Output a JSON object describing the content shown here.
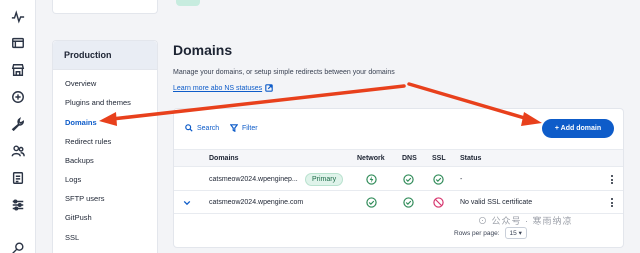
{
  "rail": {
    "icons": [
      "activity-icon",
      "window-icon",
      "store-icon",
      "plus-circle-icon",
      "wrench-icon",
      "users-icon",
      "document-icon",
      "sliders-icon",
      "search-icon"
    ]
  },
  "env_nav": {
    "heading": "Production",
    "items": [
      "Overview",
      "Plugins and themes",
      "Domains",
      "Redirect rules",
      "Backups",
      "Logs",
      "SFTP users",
      "GitPush",
      "SSL"
    ],
    "active_index": 2
  },
  "main": {
    "title": "Domains",
    "description": "Manage your domains, or setup simple redirects between your domains",
    "learn_link": "Learn more abo  NS statuses",
    "search_label": "Search",
    "filter_label": "Filter",
    "add_button": "+ Add domain"
  },
  "table": {
    "headers": [
      "Domains",
      "Network",
      "DNS",
      "SSL",
      "Status"
    ],
    "rows": [
      {
        "domain": "catsmeow2024.wpenginep...",
        "badge": "Primary",
        "network": "network-active-icon",
        "dns": "check",
        "ssl": "check",
        "status": "-"
      },
      {
        "domain": "catsmeow2024.wpengine.com",
        "badge": "",
        "network": "check",
        "dns": "check",
        "ssl": "prohibited",
        "status": "No valid SSL certificate"
      }
    ]
  },
  "pagination": {
    "label": "Rows per page:",
    "value": "15"
  },
  "colors": {
    "accent": "#0e5cc9",
    "success": "#2e8a57",
    "danger": "#d6336c",
    "arrow": "#e8401c"
  }
}
